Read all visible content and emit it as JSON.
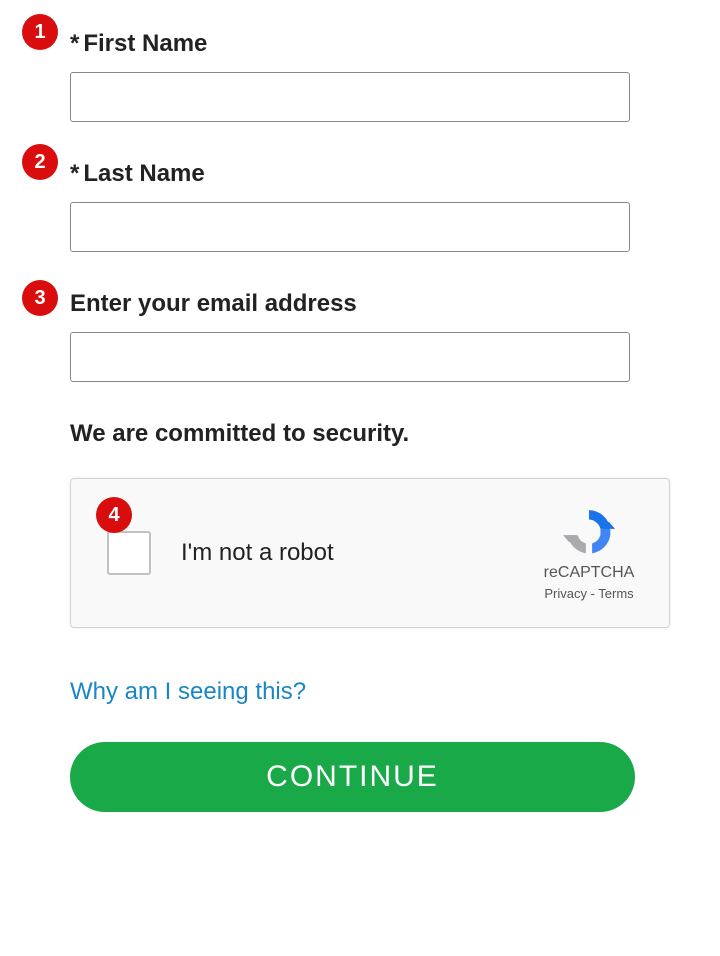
{
  "badges": [
    "1",
    "2",
    "3",
    "4"
  ],
  "fields": {
    "first_name": {
      "label": "First Name",
      "required_marker": "*",
      "value": ""
    },
    "last_name": {
      "label": "Last Name",
      "required_marker": "*",
      "value": ""
    },
    "email": {
      "label": "Enter your email address",
      "value": ""
    }
  },
  "security_text": "We are committed to security.",
  "recaptcha": {
    "checkbox_label": "I'm not a robot",
    "brand": "reCAPTCHA",
    "privacy": "Privacy",
    "separator": " - ",
    "terms": "Terms"
  },
  "why_link": "Why am I seeing this?",
  "continue_button": "CONTINUE"
}
